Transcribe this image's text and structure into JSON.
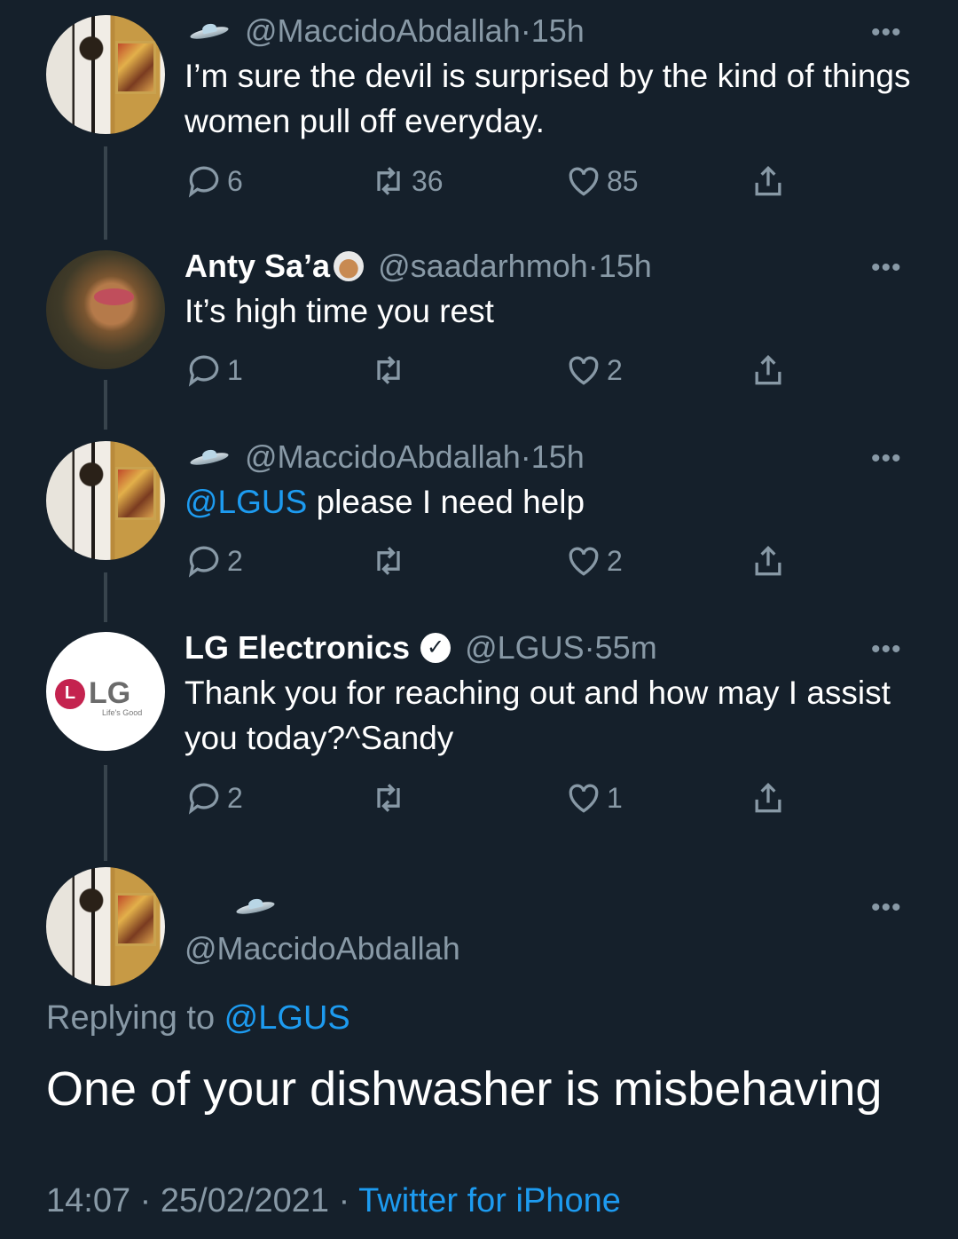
{
  "tweets": [
    {
      "name": "",
      "handle": "@MaccidoAbdallah",
      "time": "15h",
      "text": "I’m sure the devil is surprised by the kind of things women pull off everyday.",
      "replies": "6",
      "retweets": "36",
      "likes": "85"
    },
    {
      "name": "Anty Sa’a",
      "handle": "@saadarhmoh",
      "time": "15h",
      "text": "It’s high time you rest",
      "replies": "1",
      "retweets": "",
      "likes": "2"
    },
    {
      "name": "",
      "handle": "@MaccidoAbdallah",
      "time": "15h",
      "mention": "@LGUS",
      "text": " please I need help",
      "replies": "2",
      "retweets": "",
      "likes": "2"
    },
    {
      "name": "LG Electronics",
      "handle": "@LGUS",
      "time": "55m",
      "text": "Thank you for reaching out and how may I assist you today?^Sandy",
      "replies": "2",
      "retweets": "",
      "likes": "1",
      "logo_text": "LG",
      "logo_mark": "L",
      "logo_slogan": "Life's Good"
    }
  ],
  "main_tweet": {
    "handle": "@MaccidoAbdallah",
    "replying_prefix": "Replying to ",
    "replying_to": "@LGUS",
    "text": "One of your dishwasher is misbehaving",
    "time": "14:07",
    "date": "25/02/2021",
    "source": "Twitter for iPhone"
  },
  "separator": " · ",
  "more_label": "•••",
  "verified_glyph": "✓",
  "colors": {
    "background": "#15202b",
    "accent": "#1d9bf0",
    "muted": "#8899a6",
    "text": "#ffffff"
  },
  "icons": [
    "ufo-icon",
    "reply-icon",
    "retweet-icon",
    "like-icon",
    "share-icon",
    "more-icon",
    "verified-icon"
  ]
}
